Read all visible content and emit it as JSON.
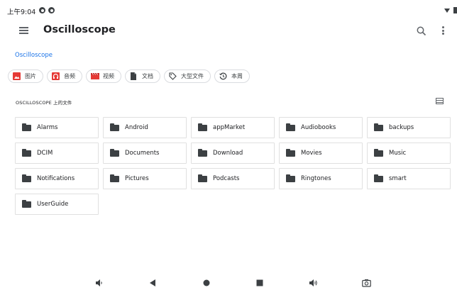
{
  "status_bar": {
    "time": "上午9:04"
  },
  "toolbar": {
    "title": "Oscilloscope",
    "menu_icon": "hamburger-menu-icon",
    "search_icon": "search-icon",
    "more_icon": "more-vert-icon"
  },
  "breadcrumb": {
    "current": "Oscilloscope"
  },
  "chips": [
    {
      "label": "图片",
      "icon": "image-icon",
      "color": "#e53935"
    },
    {
      "label": "音频",
      "icon": "audio-icon",
      "color": "#e53935"
    },
    {
      "label": "视频",
      "icon": "video-icon",
      "color": "#e53935"
    },
    {
      "label": "文档",
      "icon": "document-icon",
      "color": "#3c4043"
    },
    {
      "label": "大型文件",
      "icon": "tag-icon",
      "color": "#3c4043"
    },
    {
      "label": "本周",
      "icon": "history-icon",
      "color": "#3c4043"
    }
  ],
  "section": {
    "title": "OSCILLOSCOPE 上的文件",
    "view_toggle_icon": "list-view-icon"
  },
  "folders": [
    "Alarms",
    "Android",
    "appMarket",
    "Audiobooks",
    "backups",
    "DCIM",
    "Documents",
    "Download",
    "Movies",
    "Music",
    "Notifications",
    "Pictures",
    "Podcasts",
    "Ringtones",
    "smart",
    "UserGuide"
  ],
  "nav_bar": [
    "volume-down-icon",
    "back-icon",
    "home-icon",
    "recents-icon",
    "volume-up-icon",
    "screenshot-icon"
  ],
  "colors": {
    "accent": "#1a73e8",
    "red_icon": "#e53935",
    "icon_gray": "#5f6368",
    "border": "#dadce0"
  }
}
